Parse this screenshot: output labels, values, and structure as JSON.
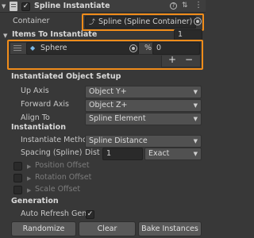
{
  "header": {
    "title": "Spline Instantiate",
    "enabled_check": "✓"
  },
  "container": {
    "label": "Container",
    "value": "Spline (Spline Container)"
  },
  "items": {
    "label": "Items To Instantiate",
    "count": "1",
    "rows": [
      {
        "name": "Sphere",
        "probability_label": "%",
        "probability": "0"
      }
    ],
    "add_label": "+",
    "remove_label": "−"
  },
  "setup": {
    "title": "Instantiated Object Setup",
    "up_axis_label": "Up Axis",
    "up_axis_value": "Object Y+",
    "forward_axis_label": "Forward Axis",
    "forward_axis_value": "Object Z+",
    "align_label": "Align To",
    "align_value": "Spline Element"
  },
  "instantiation": {
    "title": "Instantiation",
    "method_label": "Instantiate Method",
    "method_value": "Spline Distance",
    "spacing_label": "Spacing (Spline)",
    "dist_label": "Dist",
    "dist_value": "1",
    "exact_value": "Exact",
    "position_offset": "Position Offset",
    "rotation_offset": "Rotation Offset",
    "scale_offset": "Scale Offset"
  },
  "generation": {
    "title": "Generation",
    "auto_refresh_label": "Auto Refresh Gene",
    "auto_refresh_check": "✓"
  },
  "buttons": {
    "randomize": "Randomize",
    "clear": "Clear",
    "bake": "Bake Instances"
  },
  "colors": {
    "highlight": "#f08c1a",
    "background": "#383838"
  }
}
